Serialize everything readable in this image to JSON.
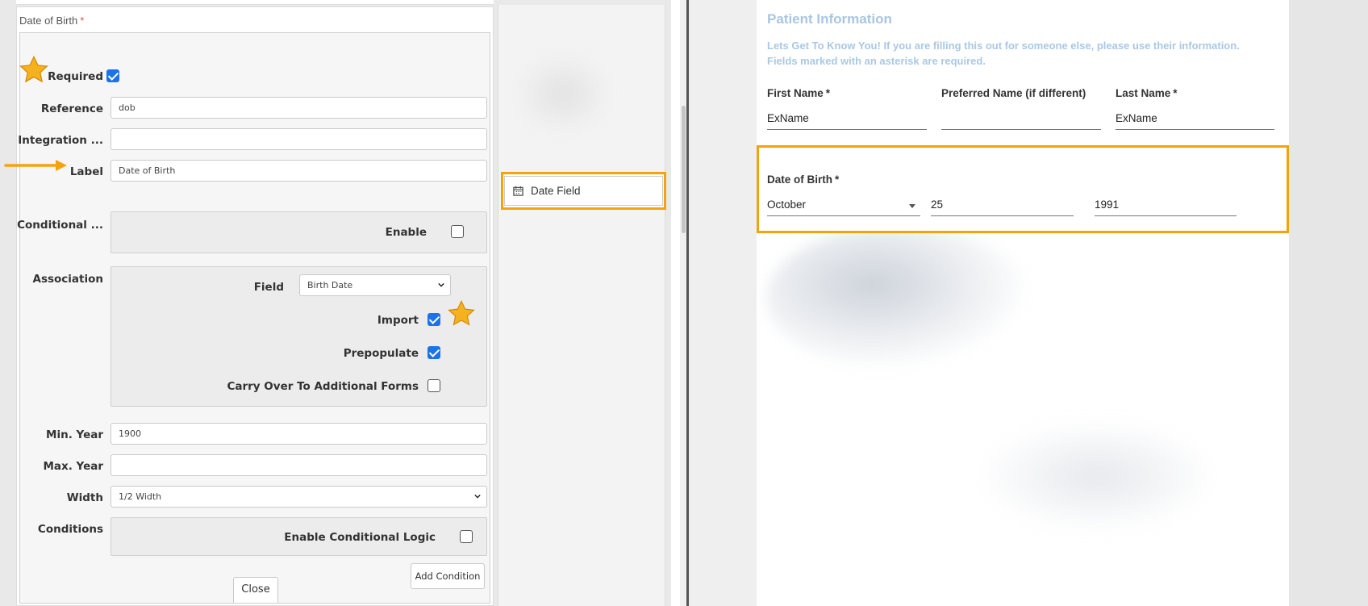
{
  "editor": {
    "card_title": "Date of Birth",
    "required_marker": "*",
    "required_label": "Required",
    "required_checked": true,
    "reference_label": "Reference",
    "reference_value": "dob",
    "integration_label": "Integration ...",
    "integration_value": "",
    "label_label": "Label",
    "label_value": "Date of Birth",
    "conditional_label": "Conditional ...",
    "enable_label": "Enable",
    "enable_checked": false,
    "association_label": "Association",
    "field_label": "Field",
    "field_value": "Birth Date",
    "import_label": "Import",
    "import_checked": true,
    "prepopulate_label": "Prepopulate",
    "prepopulate_checked": true,
    "carry_over_label": "Carry Over To Additional Forms",
    "carry_over_checked": false,
    "min_year_label": "Min. Year",
    "min_year_value": "1900",
    "max_year_label": "Max. Year",
    "max_year_value": "",
    "width_label": "Width",
    "width_value": "1/2 Width",
    "conditions_label": "Conditions",
    "enable_logic_label": "Enable Conditional Logic",
    "enable_logic_checked": false,
    "add_condition_label": "Add Condition",
    "close_label": "Close"
  },
  "palette": {
    "date_field_label": "Date Field",
    "date_field_icon": "calendar-icon"
  },
  "preview": {
    "section_title": "Patient Information",
    "intro_line1": "Lets Get To Know You! If you are filling this out for someone else, please use their information.",
    "intro_line2": "Fields marked with an asterisk are required.",
    "first_name_label": "First Name",
    "first_name_value": "ExName",
    "preferred_name_label": "Preferred Name (if different)",
    "preferred_name_value": "",
    "last_name_label": "Last Name",
    "last_name_value": "ExName",
    "dob_label": "Date of Birth",
    "month_value": "October",
    "day_value": "25",
    "year_value": "1991",
    "asterisk": "*"
  },
  "colors": {
    "highlight": "#f5a30c",
    "checkbox_blue": "#1a73e8",
    "title_blue": "#a8c6e2",
    "required_red": "#d9534f"
  }
}
